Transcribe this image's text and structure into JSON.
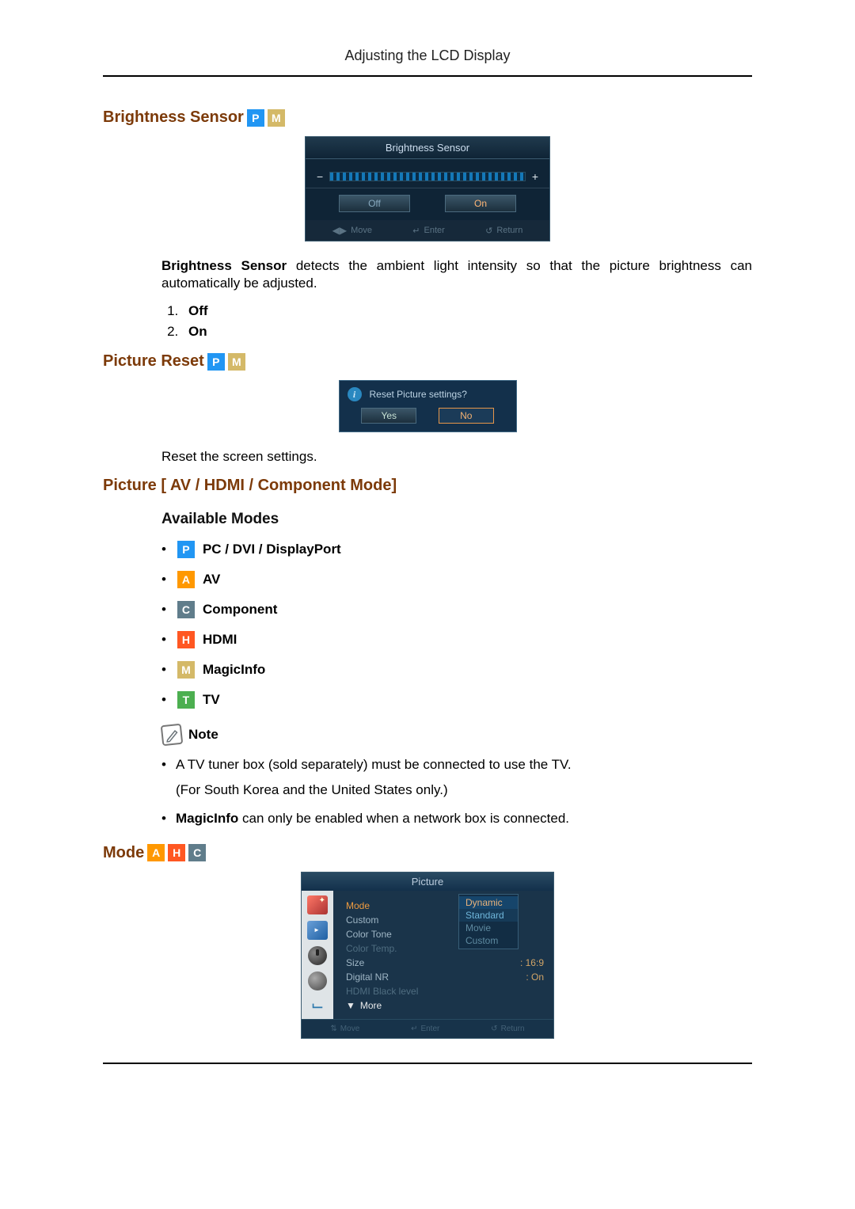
{
  "header": {
    "title": "Adjusting the LCD Display"
  },
  "sec1": {
    "heading": "Brightness Sensor",
    "badges": [
      "P",
      "M"
    ],
    "osd": {
      "title": "Brightness Sensor",
      "off": "Off",
      "on": "On",
      "footer": {
        "move": "Move",
        "enter": "Enter",
        "return": "Return"
      },
      "minus": "−",
      "plus": "+"
    },
    "desc_prefix_bold": "Brightness Sensor",
    "desc_rest": " detects the ambient light intensity so that the picture brightness can automatically be adjusted.",
    "items": [
      "Off",
      "On"
    ]
  },
  "sec2": {
    "heading": "Picture Reset",
    "badges": [
      "P",
      "M"
    ],
    "osd": {
      "question": "Reset Picture settings?",
      "yes": "Yes",
      "no": "No"
    },
    "desc": "Reset the screen settings."
  },
  "sec3": {
    "heading": "Picture [ AV / HDMI / Component Mode]",
    "available_heading": "Available Modes",
    "modes": [
      {
        "badge": "P",
        "label": " PC / DVI / DisplayPort"
      },
      {
        "badge": "A",
        "label": " AV"
      },
      {
        "badge": "C",
        "label": " Component"
      },
      {
        "badge": "H",
        "label": " HDMI"
      },
      {
        "badge": "M",
        "label": " MagicInfo"
      },
      {
        "badge": "T",
        "label": " TV"
      }
    ],
    "note_label": "Note",
    "notes": {
      "n1_line1": "A TV tuner box (sold separately) must be connected to use the TV.",
      "n1_line2": "(For South Korea and the United States only.)",
      "n2_bold": "MagicInfo",
      "n2_rest": " can only be enabled when a network box is connected."
    }
  },
  "sec4": {
    "heading": "Mode",
    "badges": [
      "A",
      "H",
      "C"
    ],
    "osd": {
      "title": "Picture",
      "rows": {
        "mode": "Mode",
        "custom": "Custom",
        "colortone": "Color Tone",
        "colortemp": "Color Temp.",
        "size": "Size",
        "size_val": ": 16:9",
        "dnr": "Digital NR",
        "dnr_val": ": On",
        "hdmi": "HDMI Black level",
        "more": "More"
      },
      "mode_options": [
        "Dynamic",
        "Standard",
        "Movie",
        "Custom"
      ],
      "footer": {
        "move": "Move",
        "enter": "Enter",
        "return": "Return"
      }
    }
  }
}
